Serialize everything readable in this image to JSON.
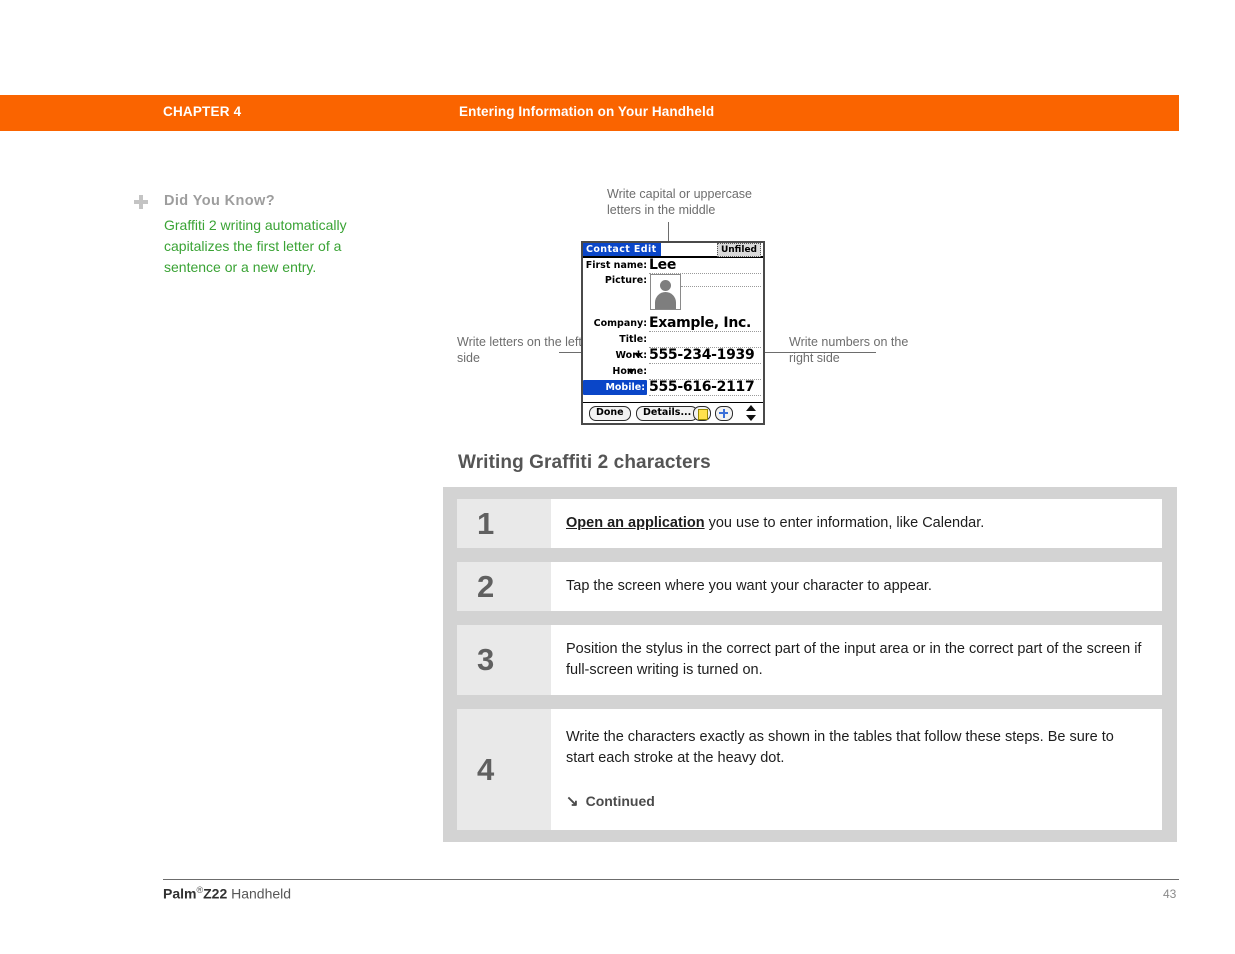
{
  "header": {
    "chapter_label": "CHAPTER 4",
    "chapter_title": "Entering Information on Your Handheld",
    "bar_color": "#FA6400"
  },
  "tip": {
    "icon": "plus-icon",
    "heading": "Did You Know?",
    "body": "Graffiti 2 writing automatically capitalizes the first letter of a sentence or a new entry.",
    "text_color": "#3AA335",
    "heading_color": "#9D9D9D"
  },
  "callouts": {
    "top": "Write capital or uppercase letters in the middle",
    "left": "Write letters on the left side",
    "right": "Write numbers on the right side"
  },
  "device": {
    "title": "Contact Edit",
    "category": "Unfiled",
    "title_bar_color": "#0A46C8",
    "fields": [
      {
        "label": "First name:",
        "value": "Lee",
        "caret": false,
        "selected": false
      },
      {
        "label": "Picture:",
        "value": "",
        "caret": false,
        "selected": false
      },
      {
        "label": "Company:",
        "value": "Example, Inc.",
        "caret": false,
        "selected": false
      },
      {
        "label": "Title:",
        "value": "",
        "caret": false,
        "selected": false
      },
      {
        "label": "Work:",
        "value": "555-234-1939",
        "caret": true,
        "selected": false
      },
      {
        "label": "Home:",
        "value": "",
        "caret": true,
        "selected": false
      },
      {
        "label": "Mobile:",
        "value": "555-616-2117",
        "caret": true,
        "selected": true
      }
    ],
    "buttons": {
      "done": "Done",
      "details": "Details...",
      "note_icon": "note-icon",
      "add_icon": "plus-icon",
      "scroll_icon": "scroll-up-down-icon"
    }
  },
  "section": {
    "heading": "Writing Graffiti 2 characters"
  },
  "steps": [
    {
      "number": "1",
      "link_text": "Open an application",
      "text": " you use to enter information, like Calendar.",
      "continued": null
    },
    {
      "number": "2",
      "link_text": "",
      "text": "Tap the screen where you want your character to appear.",
      "continued": null
    },
    {
      "number": "3",
      "link_text": "",
      "text": "Position the stylus in the correct part of the input area or in the correct part of the screen if full-screen writing is turned on.",
      "continued": null
    },
    {
      "number": "4",
      "link_text": "",
      "text": "Write the characters exactly as shown in the tables that follow these steps. Be sure to start each stroke at the heavy dot.",
      "continued": "Continued",
      "continued_arrow": "↘"
    }
  ],
  "footer": {
    "brand": "Palm",
    "registered": "®",
    "model": "Z22",
    "product": " Handheld",
    "page_number": "43"
  }
}
